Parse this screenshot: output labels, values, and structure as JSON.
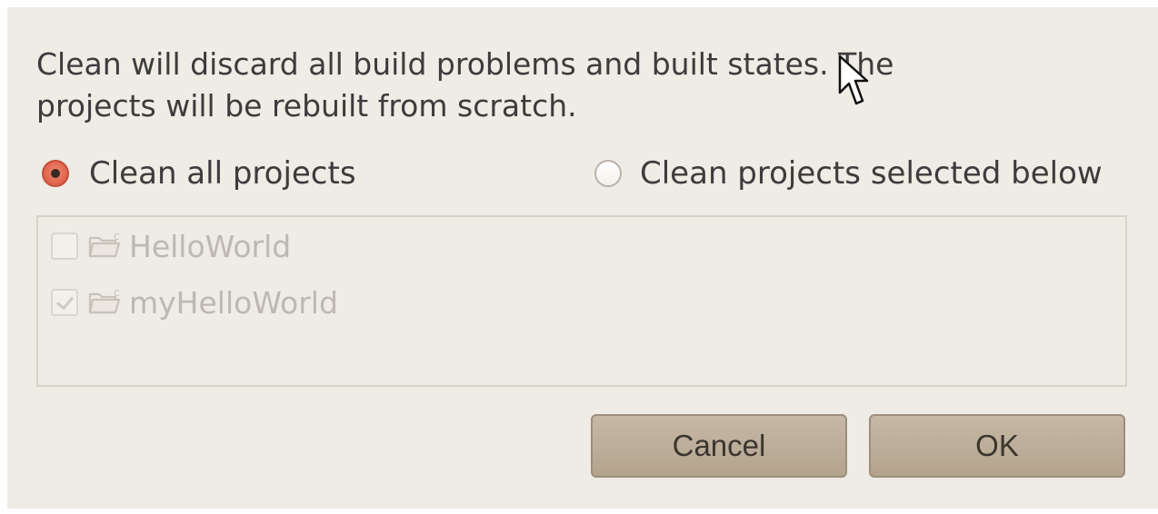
{
  "message": {
    "line1": "Clean will discard all build problems and built states.  The",
    "line2": "projects will be rebuilt from scratch."
  },
  "options": {
    "clean_all_label": "Clean all projects",
    "clean_selected_label": "Clean projects selected below",
    "selected": "clean_all"
  },
  "projects": [
    {
      "name": "HelloWorld",
      "checked": false,
      "enabled": false
    },
    {
      "name": "myHelloWorld",
      "checked": true,
      "enabled": false
    }
  ],
  "buttons": {
    "cancel_label": "Cancel",
    "ok_label": "OK"
  },
  "icons": {
    "project": "project-folder-icon",
    "pointer": "mouse-pointer-icon"
  },
  "colors": {
    "dialog_background": "#efebe5",
    "selected_radio": "#e2674f",
    "button_background": "#bcae9a",
    "disabled_text": "#bdb8b1"
  }
}
